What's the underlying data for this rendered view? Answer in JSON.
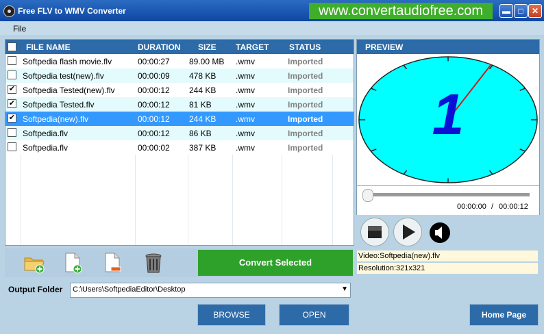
{
  "window": {
    "title": "Free FLV to WMV Converter",
    "promo": "www.convertaudiofree.com",
    "minimize": "▬",
    "maximize": "□",
    "close": "✕"
  },
  "menu": {
    "file": "File"
  },
  "table": {
    "headers": {
      "file": "FILE NAME",
      "duration": "DURATION",
      "size": "SIZE",
      "target": "TARGET",
      "status": "STATUS"
    },
    "rows": [
      {
        "name": "Softpedia flash movie.flv",
        "duration": "00:00:27",
        "size": "89.00 MB",
        "target": ".wmv",
        "status": "Imported",
        "checked": false,
        "selected": false
      },
      {
        "name": "Softpedia test(new).flv",
        "duration": "00:00:09",
        "size": "478 KB",
        "target": ".wmv",
        "status": "Imported",
        "checked": false,
        "selected": false
      },
      {
        "name": "Softpedia Tested(new).flv",
        "duration": "00:00:12",
        "size": "244 KB",
        "target": ".wmv",
        "status": "Imported",
        "checked": true,
        "selected": false
      },
      {
        "name": "Softpedia Tested.flv",
        "duration": "00:00:12",
        "size": "81 KB",
        "target": ".wmv",
        "status": "Imported",
        "checked": true,
        "selected": false
      },
      {
        "name": "Softpedia(new).flv",
        "duration": "00:00:12",
        "size": "244 KB",
        "target": ".wmv",
        "status": "Imported",
        "checked": true,
        "selected": true
      },
      {
        "name": "Softpedia.flv",
        "duration": "00:00:12",
        "size": "86 KB",
        "target": ".wmv",
        "status": "Imported",
        "checked": false,
        "selected": false
      },
      {
        "name": "Softpedia.flv",
        "duration": "00:00:02",
        "size": "387 KB",
        "target": ".wmv",
        "status": "Imported",
        "checked": false,
        "selected": false
      }
    ]
  },
  "toolbar": {
    "add_folder_icon": "folder-add-icon",
    "add_file_icon": "file-add-icon",
    "remove_icon": "file-remove-icon",
    "trash_icon": "trash-icon",
    "convert_label": "Convert Selected"
  },
  "output": {
    "label": "Output Folder",
    "path": "C:\\Users\\SoftpediaEditor\\Desktop"
  },
  "buttons": {
    "browse": "BROWSE",
    "open": "OPEN",
    "home": "Home Page"
  },
  "preview": {
    "header": "PREVIEW",
    "current_time": "00:00:00",
    "separator": "/",
    "total_time": "00:00:12",
    "seek_fraction": 0,
    "frame_digit": "1",
    "video_info": "Video:Softpedia(new).flv",
    "resolution": "Resolution:321x321"
  },
  "colors": {
    "header_blue": "#2d6ba8",
    "row_alt": "#e4fbfd",
    "selected_row": "#3399ff",
    "convert_green": "#2ea12a",
    "promo_green": "#3fae2a",
    "clock_face": "#00ffff"
  }
}
